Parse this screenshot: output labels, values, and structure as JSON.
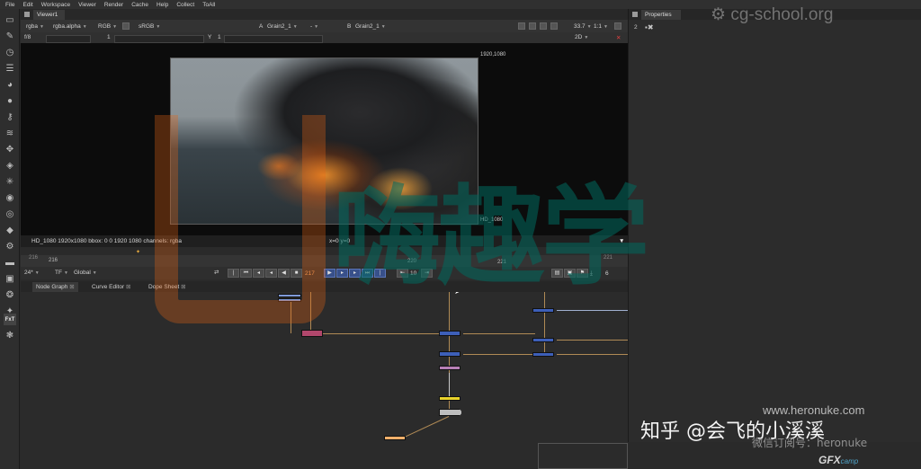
{
  "menubar": [
    "File",
    "Edit",
    "Workspace",
    "Viewer",
    "Render",
    "Cache",
    "Help",
    "Collect",
    "ToAll"
  ],
  "toolbar_icons": [
    "viewer-icon",
    "draw-icon",
    "time-icon",
    "channel-icon",
    "color-icon",
    "filter-icon",
    "keyer-icon",
    "merge-icon",
    "transform-icon",
    "3d-icon",
    "particles-icon",
    "deep-icon",
    "views-icon",
    "metadata-icon",
    "toolsets-icon",
    "other-icon",
    "image-icon",
    "furnace-icon",
    "furnace-core-icon",
    "fxt-icon",
    "gear-icon"
  ],
  "viewer": {
    "tab_label": "Viewer1",
    "controls": {
      "layer": "rgba",
      "channel": "rgba.alpha",
      "display": "RGB",
      "colorspace": "sRGB",
      "input_a_label": "A",
      "input_a": "Grain2_1",
      "wipe": "-",
      "input_b_label": "B",
      "input_b": "Grain2_1",
      "gain": "33.7",
      "zoom": "1:1",
      "fstop": "f/8",
      "frame_field": "1",
      "y_label": "Y",
      "y_field": "1",
      "mode": "2D"
    },
    "format_top_right": "1920,1080",
    "format_bottom_right": "HD_1080",
    "info_left": "HD_1080 1920x1080  bbox: 0 0 1920 1080 channels: rgba",
    "info_coords": "x=0 y=0"
  },
  "timeline": {
    "start": "216",
    "start_marker": "216",
    "mid": "220",
    "current": "221",
    "end": "221"
  },
  "playback": {
    "fps": "24*",
    "tf": "TF",
    "range": "Global",
    "frame": "217",
    "step": "10",
    "count": "6"
  },
  "node_graph": {
    "tabs": [
      "Node Graph",
      "Curve Editor",
      "Dope Sheet"
    ]
  },
  "properties": {
    "tab_label": "Properties",
    "count": "2"
  },
  "watermarks": {
    "cg_school": "cg-school.org",
    "brand": "嗨趣学",
    "site": "www.heronuke.com",
    "zhihu": "知乎 @会飞的小溪溪",
    "wechat": "微信订阅号：heronuke",
    "gfx": "GFX",
    "gfx_sub": "camp"
  },
  "colors": {
    "node_blue": "#3d5fb8",
    "node_purple": "#b77fb6",
    "node_red": "#b1476c",
    "node_yellow": "#e8d22a",
    "node_orange": "#f0b06a",
    "wire": "#b08a55"
  }
}
